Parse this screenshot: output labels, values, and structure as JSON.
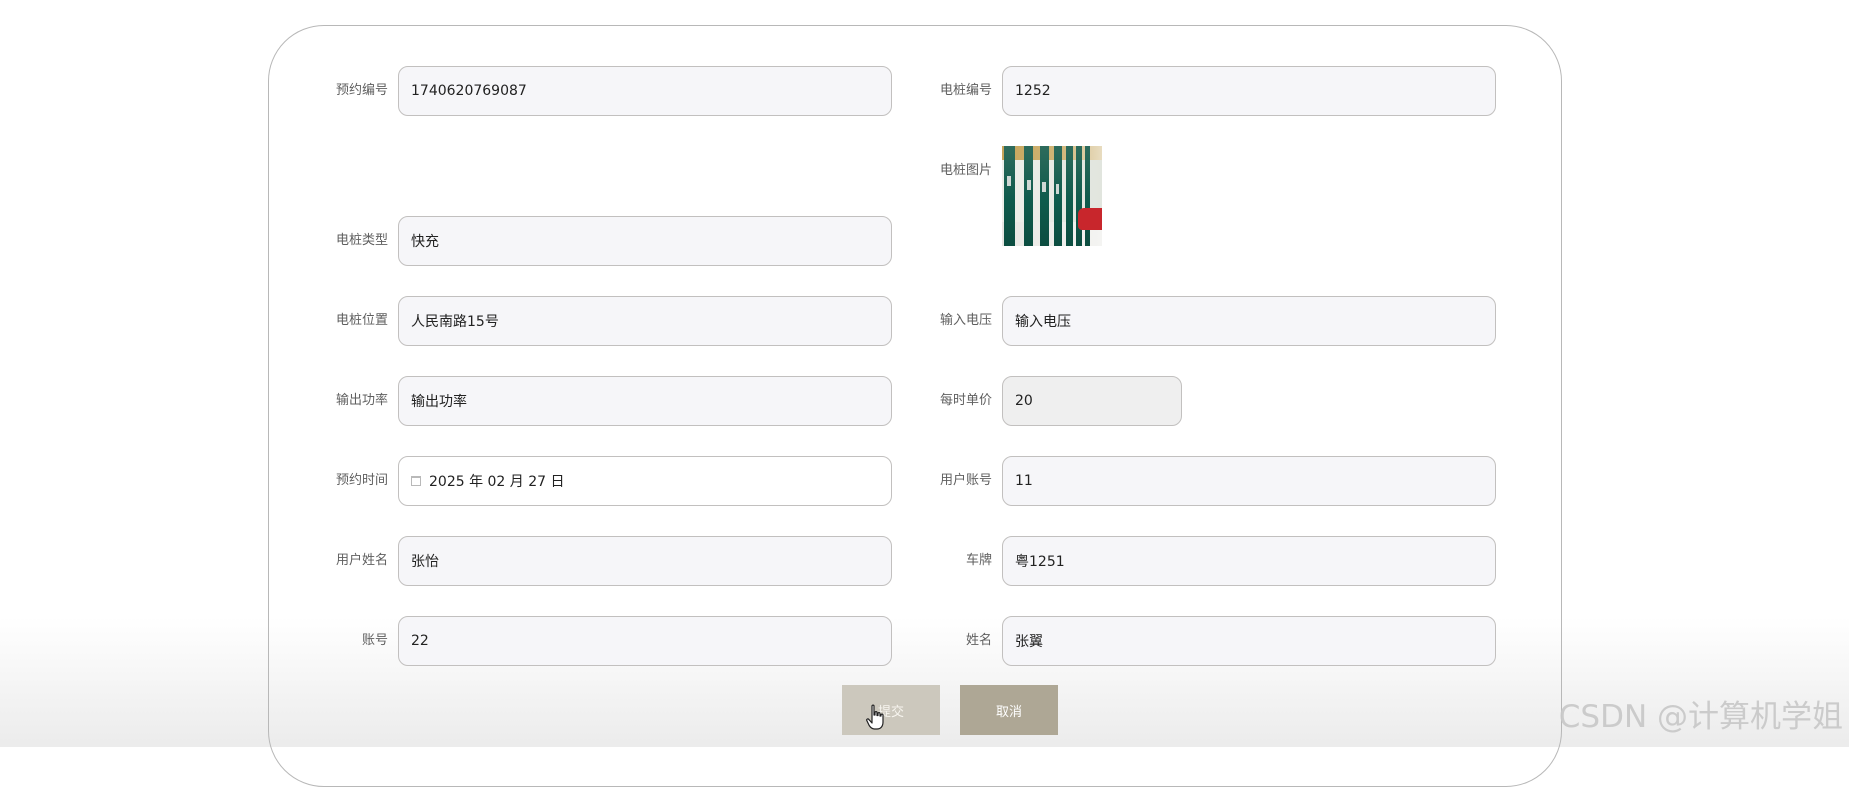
{
  "form": {
    "reservation_no": {
      "label": "预约编号",
      "value": "1740620769087"
    },
    "pile_no": {
      "label": "电桩编号",
      "value": "1252"
    },
    "pile_image": {
      "label": "电桩图片"
    },
    "pile_type": {
      "label": "电桩类型",
      "value": "快充"
    },
    "pile_location": {
      "label": "电桩位置",
      "value": "人民南路15号"
    },
    "input_voltage": {
      "label": "输入电压",
      "value": "输入电压"
    },
    "output_power": {
      "label": "输出功率",
      "value": "输出功率"
    },
    "hourly_price": {
      "label": "每时单价",
      "value": "20"
    },
    "reservation_time": {
      "label": "预约时间",
      "value": "2025 年 02 月 27 日",
      "icon": "calendar-icon"
    },
    "user_account": {
      "label": "用户账号",
      "value": "11"
    },
    "user_name": {
      "label": "用户姓名",
      "value": "张怡"
    },
    "plate": {
      "label": "车牌",
      "value": "粤1251"
    },
    "account": {
      "label": "账号",
      "value": "22"
    },
    "name": {
      "label": "姓名",
      "value": "张翼"
    }
  },
  "buttons": {
    "submit": "提交",
    "cancel": "取消"
  },
  "watermark": "CSDN @计算机学姐",
  "colors": {
    "input_bg": "#f6f6f9",
    "input_border": "#c2c0bf",
    "readonly_bg": "#efefef",
    "submit_bg": "#ccc8bd",
    "cancel_bg": "#aea795",
    "card_border": "#b8b8b8"
  }
}
